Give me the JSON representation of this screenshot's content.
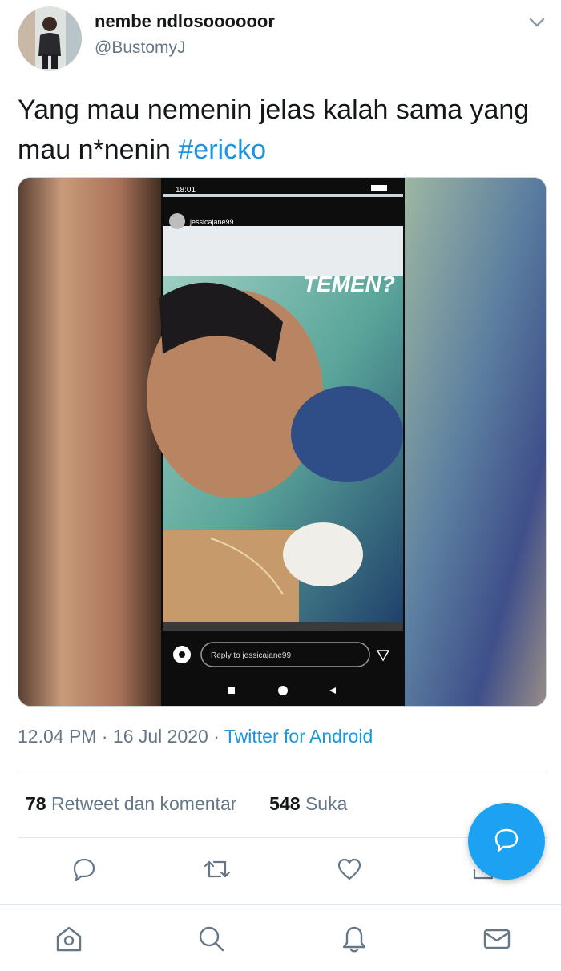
{
  "tweet": {
    "display_name": "nembe ndlosoooooor",
    "handle": "@BustomyJ",
    "text": "Yang mau nemenin jelas kalah sama yang mau n*nenin",
    "hashtag": "#ericko",
    "time": "12.04 PM",
    "date": "16 Jul 2020",
    "separator": "·",
    "source": "Twitter for Android"
  },
  "media": {
    "status_time": "18:01",
    "story_user": "jessicajane99",
    "story_caption": "TEMEN?",
    "reply_placeholder": "Reply to jessicajane99"
  },
  "stats": {
    "retweets_count": "78",
    "retweets_label": "Retweet dan komentar",
    "likes_count": "548",
    "likes_label": "Suka"
  },
  "icons": {
    "menu": "chevron-down-icon",
    "reply": "reply-icon",
    "retweet": "retweet-icon",
    "like": "heart-icon",
    "share": "share-icon",
    "compose": "compose-icon",
    "home": "home-icon",
    "search": "search-icon",
    "notifications": "bell-icon",
    "messages": "mail-icon"
  },
  "colors": {
    "accent": "#1da1f2",
    "link": "#1b95e0",
    "secondary_text": "#657786",
    "primary_text": "#14171a"
  }
}
